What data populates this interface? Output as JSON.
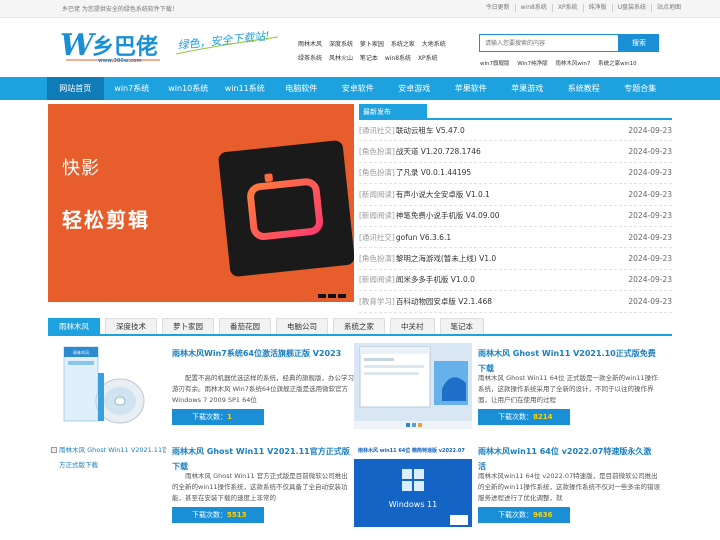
{
  "topbar": {
    "slogan": "乡巴佬  为您提供安全的绿色系统软件下载！",
    "links": [
      "今日更新",
      "win8系统",
      "XP系统",
      "纯净版",
      "U盘装系统",
      "站点地图"
    ]
  },
  "logo": {
    "site_url": "www.386w.com",
    "tagline": "绿色，安全下载站!"
  },
  "quicklinks": [
    "雨林木风",
    "深度系统",
    "萝卜家园",
    "系统之家",
    "大地系统",
    "绿茶系统",
    "风林火山",
    "笔记本",
    "win8系统",
    "XP系统"
  ],
  "search": {
    "placeholder": "请输入您要搜索的内容",
    "button_label": "搜索",
    "hotwords": [
      "win7旗舰版",
      "Win7纯净版",
      "雨林木风win7",
      "系统之家win10"
    ]
  },
  "nav": {
    "items": [
      "网站首页",
      "win7系统",
      "win10系统",
      "win11系统",
      "电脑软件",
      "安卓软件",
      "安卓游戏",
      "苹果软件",
      "苹果游戏",
      "系统教程",
      "专题合集"
    ]
  },
  "banner": {
    "line1": "快影",
    "line2": "轻松剪辑"
  },
  "news": {
    "heading": "最新发布",
    "items": [
      {
        "cat": "[通讯社交]",
        "title": "联动云租车 V5.47.0",
        "date": "2024-09-23"
      },
      {
        "cat": "[角色扮演]",
        "title": "战天道 V1.20.728.1746",
        "date": "2024-09-23"
      },
      {
        "cat": "[角色扮演]",
        "title": "了凡录 V0.0.1.44195",
        "date": "2024-09-23"
      },
      {
        "cat": "[新闻阅读]",
        "title": "有声小说大全安卓版 V1.0.1",
        "date": "2024-09-23"
      },
      {
        "cat": "[新闻阅读]",
        "title": "神笔免费小说手机版 V4.09.00",
        "date": "2024-09-23"
      },
      {
        "cat": "[通讯社交]",
        "title": "gofun V6.3.6.1",
        "date": "2024-09-23"
      },
      {
        "cat": "[角色扮演]",
        "title": "黎明之海游戏(暂未上线) V1.0",
        "date": "2024-09-23"
      },
      {
        "cat": "[新闻阅读]",
        "title": "闻米多多手机版 V1.0.0",
        "date": "2024-09-23"
      },
      {
        "cat": "[教育学习]",
        "title": "百科动物园安卓版 V2.1.468",
        "date": "2024-09-23"
      }
    ]
  },
  "tabs": [
    "雨林木风",
    "深度技术",
    "萝卜家园",
    "番茄花园",
    "电脑公司",
    "系统之家",
    "中关村",
    "笔记本"
  ],
  "download_label": "下载次数：",
  "cards": [
    {
      "title": "雨林木风Win7系统64位激活旗舰正版 V2023",
      "desc": "配置不高的机器优选这样的系统，经典的旗舰版，办公学习游刃有余。雨林木风 Win7系统64位旗舰正版是选用微软官方 Windows 7 2009 SP1 64位",
      "count": "1",
      "thumb_text": "雨林木风"
    },
    {
      "title": "雨林木风 Ghost Win11 V2021.10正式版免费下载",
      "desc": "雨林木风 Ghost Win11 64位 正式版是一款全新的win11操作系统，这款操作系统采用了全新的设计，不同于以往的操作界面，让用户们在使用的过程",
      "count": "8214",
      "thumb_text": ""
    },
    {
      "title": "雨林木风 Ghost Win11 V2021.11官方正式版下载",
      "desc": "雨林木风 Ghost Win11 官方正式版是目前微软公司推出的全新的win11操作系统，这款系统不仅具备了全自动安装功能，甚至在安装下载的速度上非常的",
      "count": "5513",
      "thumb_text": "雨林木风 Ghost Win11 V2021.11官方正式版下载"
    },
    {
      "title": "雨林木风win11 64位 v2022.07特速版永久激活",
      "desc": "雨林木风win11 64位 v2022.07特速版，是目前微软公司推出的全新的win11操作系统，这款操作系统不仅对一些多余的错误服务进程进行了优化调整，就",
      "count": "9636",
      "thumb_text": "雨林木风 win11 64位 精简特速版 v2022.07"
    }
  ],
  "colors": {
    "brand_blue": "#1ea2df",
    "nav_active": "#0f7cb8",
    "banner_orange": "#e85d2c",
    "count_yellow": "#ffd400"
  }
}
